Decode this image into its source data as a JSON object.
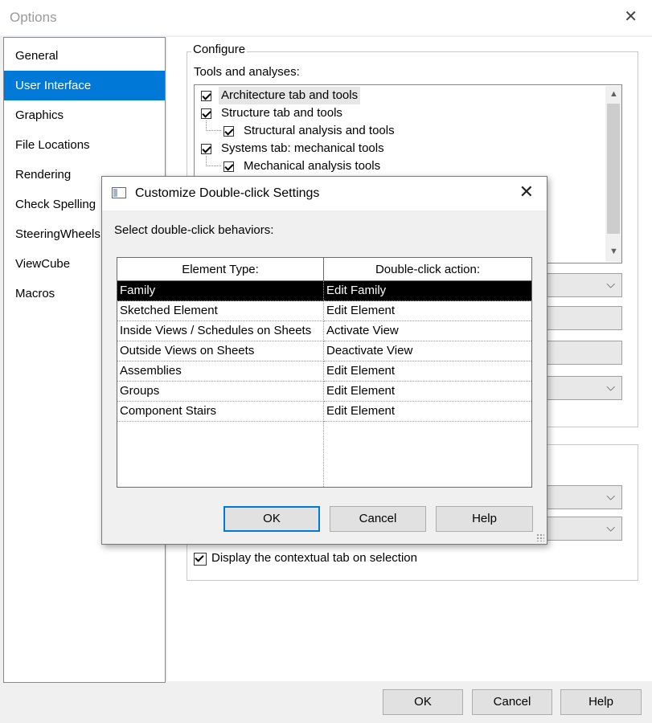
{
  "window": {
    "title": "Options",
    "close_icon": "close-icon"
  },
  "nav": {
    "items": [
      {
        "label": "General",
        "selected": false
      },
      {
        "label": "User Interface",
        "selected": true
      },
      {
        "label": "Graphics",
        "selected": false
      },
      {
        "label": "File Locations",
        "selected": false
      },
      {
        "label": "Rendering",
        "selected": false
      },
      {
        "label": "Check Spelling",
        "selected": false
      },
      {
        "label": "SteeringWheels",
        "selected": false
      },
      {
        "label": "ViewCube",
        "selected": false
      },
      {
        "label": "Macros",
        "selected": false
      }
    ]
  },
  "configure": {
    "legend": "Configure",
    "tools_label": "Tools and analyses:",
    "tree": [
      {
        "label": "Architecture tab and tools",
        "checked": true,
        "level": 0
      },
      {
        "label": "Structure tab and tools",
        "checked": true,
        "level": 0
      },
      {
        "label": "Structural analysis and tools",
        "checked": true,
        "level": 1
      },
      {
        "label": "Systems tab: mechanical tools",
        "checked": true,
        "level": 0
      },
      {
        "label": "Mechanical analysis tools",
        "checked": true,
        "level": 1
      }
    ],
    "contextual_tab_label": "Display the contextual tab on selection",
    "contextual_tab_checked": true
  },
  "footer": {
    "ok": "OK",
    "cancel": "Cancel",
    "help": "Help"
  },
  "dialog": {
    "title": "Customize Double-click Settings",
    "prompt": "Select double-click behaviors:",
    "columns": [
      "Element Type:",
      "Double-click action:"
    ],
    "rows": [
      {
        "element": "Family",
        "action": "Edit Family",
        "selected": true
      },
      {
        "element": "Sketched Element",
        "action": "Edit Element",
        "selected": false
      },
      {
        "element": "Inside Views / Schedules on Sheets",
        "action": "Activate View",
        "selected": false
      },
      {
        "element": "Outside Views on Sheets",
        "action": "Deactivate View",
        "selected": false
      },
      {
        "element": "Assemblies",
        "action": "Edit Element",
        "selected": false
      },
      {
        "element": "Groups",
        "action": "Edit Element",
        "selected": false
      },
      {
        "element": "Component Stairs",
        "action": "Edit Element",
        "selected": false
      }
    ],
    "ok": "OK",
    "cancel": "Cancel",
    "help": "Help"
  },
  "colors": {
    "selection": "#0078d7",
    "grid_selection": "#000000"
  }
}
